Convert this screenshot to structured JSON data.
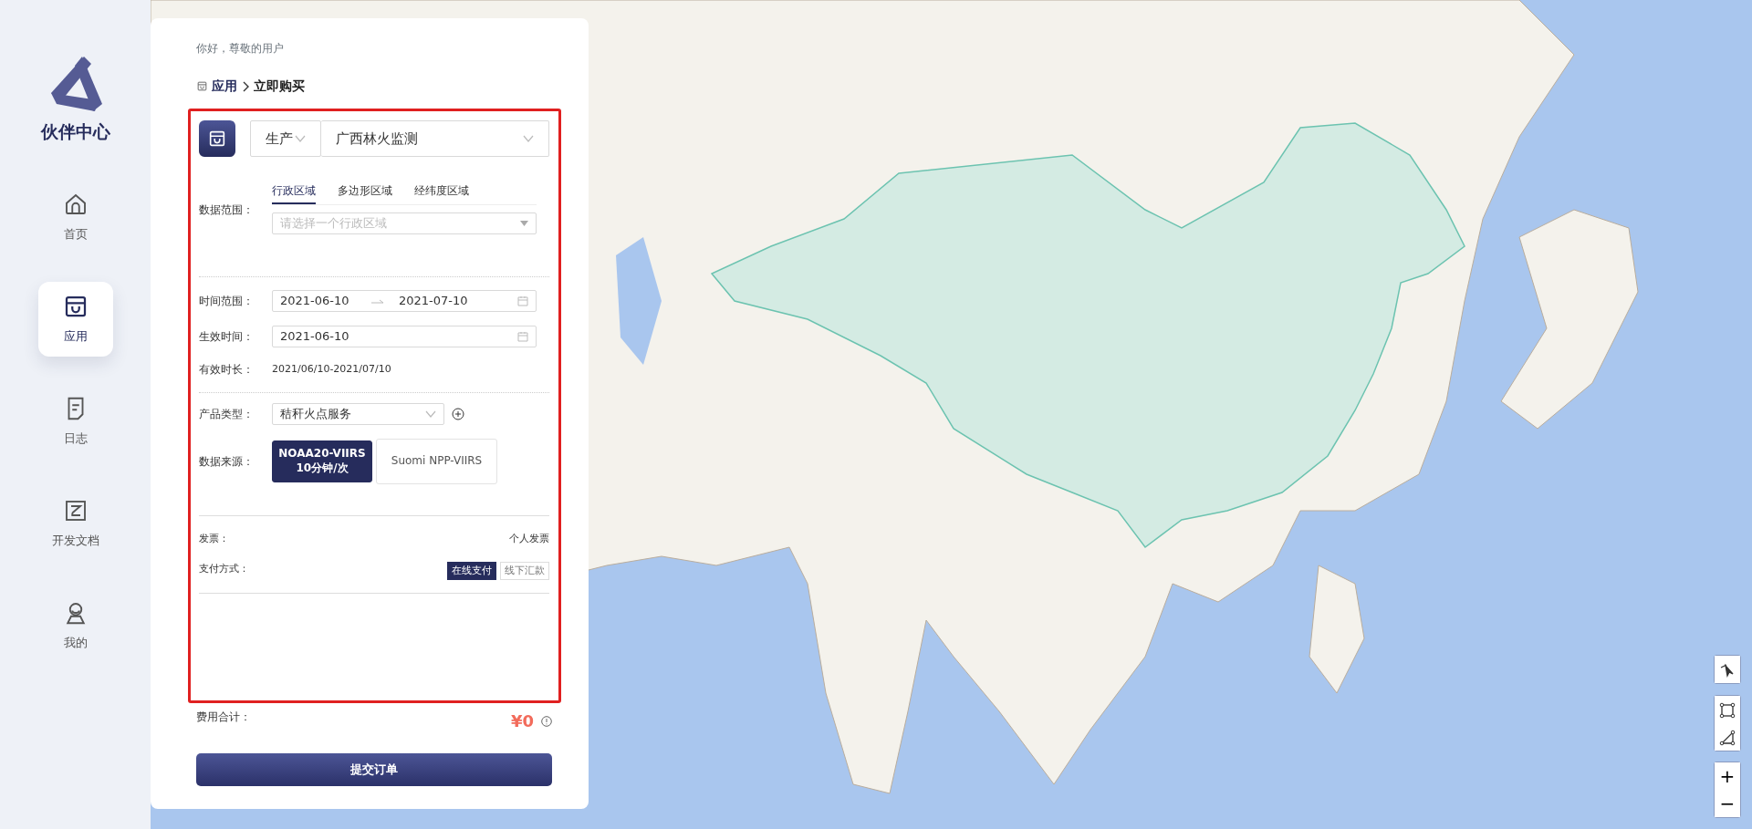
{
  "sidebar": {
    "brand": "伙伴中心",
    "items": [
      {
        "label": "首页",
        "kind": "home",
        "selected": false
      },
      {
        "label": "应用",
        "kind": "bag",
        "selected": true
      },
      {
        "label": "日志",
        "kind": "doc",
        "selected": false
      },
      {
        "label": "开发文档",
        "kind": "book",
        "selected": false
      },
      {
        "label": "我的",
        "kind": "user",
        "selected": false
      }
    ]
  },
  "panel": {
    "greeting": "你好，尊敬的用户",
    "breadcrumb": [
      "应用",
      "立即购买"
    ],
    "app_select": {
      "env": "生产",
      "app": "广西林火监测"
    },
    "data_range": {
      "label": "数据范围：",
      "tabs": [
        {
          "label": "行政区域",
          "selected": true
        },
        {
          "label": "多边形区域",
          "selected": false
        },
        {
          "label": "经纬度区域",
          "selected": false
        }
      ],
      "placeholder": "请选择一个行政区域"
    },
    "time_range": {
      "label": "时间范围：",
      "start": "2021-06-10",
      "end": "2021-07-10"
    },
    "effective_time": {
      "label": "生效时间：",
      "value": "2021-06-10"
    },
    "duration": {
      "label": "有效时长：",
      "value": "2021/06/10-2021/07/10"
    },
    "product_type": {
      "label": "产品类型：",
      "value": "秸秆火点服务"
    },
    "data_source": {
      "label": "数据来源：",
      "options": [
        {
          "lines": [
            "NOAA20-VIIRS",
            "10分钟/次"
          ],
          "selected": true
        },
        {
          "lines": [
            "Suomi NPP-VIIRS"
          ],
          "selected": false
        }
      ]
    },
    "invoice": {
      "label": "发票：",
      "value": "个人发票"
    },
    "payment": {
      "label": "支付方式：",
      "options": [
        {
          "label": "在线支付",
          "selected": true
        },
        {
          "label": "线下汇款",
          "selected": false
        }
      ]
    },
    "total": {
      "label": "费用合计：",
      "value": "¥0"
    },
    "submit": "提交订单"
  },
  "map_controls": {
    "zoom_in": "+",
    "zoom_out": "−"
  }
}
